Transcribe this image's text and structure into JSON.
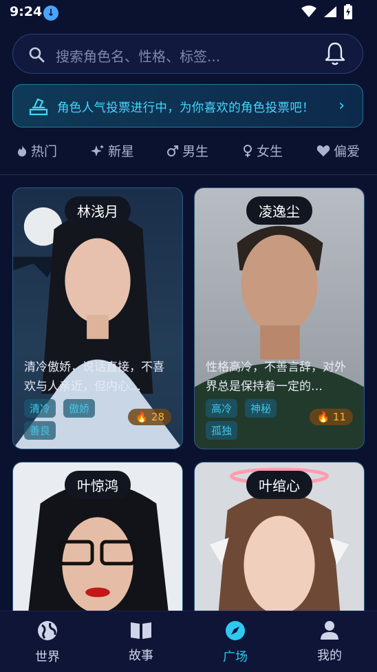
{
  "status": {
    "time": "9:24",
    "download_icon": "download-icon"
  },
  "search": {
    "placeholder": "搜索角色名、性格、标签..."
  },
  "banner": {
    "text": "角色人气投票进行中，为你喜欢的角色投票吧！",
    "arrow": "›"
  },
  "tabs": [
    {
      "label": "热门",
      "icon": "flame-icon"
    },
    {
      "label": "新星",
      "icon": "sparkle-icon"
    },
    {
      "label": "男生",
      "icon": "male-icon"
    },
    {
      "label": "女生",
      "icon": "female-icon"
    },
    {
      "label": "偏爱",
      "icon": "heart-icon"
    }
  ],
  "cards": [
    {
      "name": "林浅月",
      "desc": "清冷傲娇，说话直接，不喜欢与人亲近，但内心…",
      "tags": [
        "清冷",
        "傲娇",
        "善良"
      ],
      "heat": "28"
    },
    {
      "name": "凌逸尘",
      "desc": "性格高冷，不善言辞，对外界总是保持着一定的…",
      "tags": [
        "高冷",
        "神秘",
        "孤独"
      ],
      "heat": "11"
    },
    {
      "name": "叶惊鸿"
    },
    {
      "name": "叶绾心"
    }
  ],
  "nav": [
    {
      "label": "世界",
      "icon": "globe-icon"
    },
    {
      "label": "故事",
      "icon": "book-icon"
    },
    {
      "label": "广场",
      "icon": "compass-icon",
      "active": true
    },
    {
      "label": "我的",
      "icon": "user-icon"
    }
  ],
  "colors": {
    "accent": "#2ec9f0",
    "background": "#0b1230",
    "heat": "#ffaf45"
  }
}
